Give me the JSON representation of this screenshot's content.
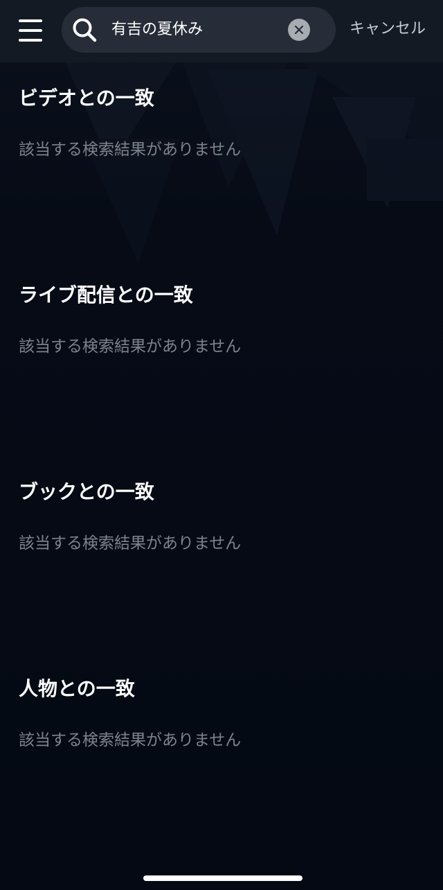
{
  "header": {
    "menu_icon": "hamburger-menu-icon",
    "search": {
      "icon": "search-icon",
      "query": "有吉の夏休み",
      "clear_icon": "clear-x-icon"
    },
    "cancel_label": "キャンセル"
  },
  "sections": [
    {
      "title": "ビデオとの一致",
      "empty_text": "該当する検索結果がありません"
    },
    {
      "title": "ライブ配信との一致",
      "empty_text": "該当する検索結果がありません"
    },
    {
      "title": "ブックとの一致",
      "empty_text": "該当する検索結果がありません"
    },
    {
      "title": "人物との一致",
      "empty_text": "該当する検索結果がありません"
    }
  ],
  "colors": {
    "background": "#050a14",
    "header": "#141a24",
    "search_field": "#262d38",
    "muted_text": "#7e838b"
  }
}
